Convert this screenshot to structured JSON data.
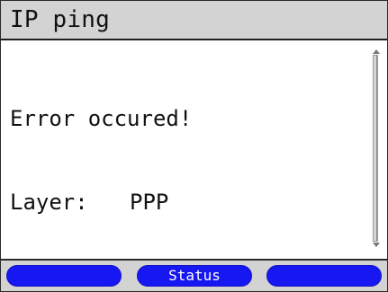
{
  "window": {
    "title": "IP ping"
  },
  "message": {
    "error_line": "Error occured!",
    "layer_label": "Layer:",
    "layer_value": "PPP"
  },
  "softkeys": {
    "left_label": "",
    "center_label": "Status",
    "right_label": ""
  },
  "colors": {
    "title_bar": "#d3d3d3",
    "softkey": "#1717f2",
    "background": "#ffffff"
  }
}
